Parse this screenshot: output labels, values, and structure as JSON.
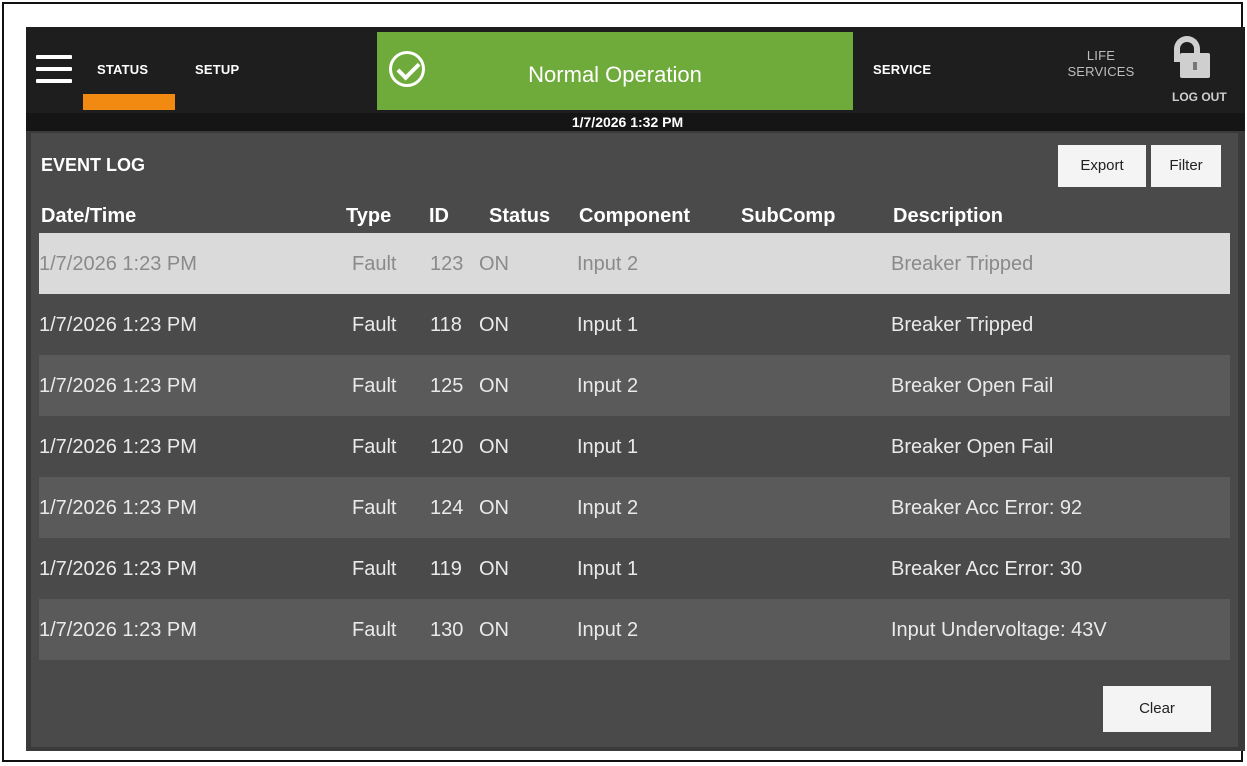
{
  "header": {
    "nav": {
      "status": "STATUS",
      "setup": "SETUP",
      "service": "SERVICE",
      "life_services_line1": "LIFE",
      "life_services_line2": "SERVICES",
      "logout": "LOG OUT"
    },
    "banner": {
      "text": "Normal Operation",
      "color": "#6fab3b"
    },
    "datetime": "1/7/2026 1:32 PM",
    "accent_color": "#f28a12",
    "icons": [
      "menu-icon",
      "check-circle-icon",
      "unlocked-padlock-icon"
    ]
  },
  "event_log": {
    "title": "EVENT LOG",
    "buttons": {
      "export": "Export",
      "filter": "Filter",
      "clear": "Clear"
    },
    "columns": {
      "datetime": "Date/Time",
      "type": "Type",
      "id": "ID",
      "status": "Status",
      "component": "Component",
      "subcomp": "SubComp",
      "description": "Description"
    },
    "rows": [
      {
        "datetime": "1/7/2026 1:23 PM",
        "type": "Fault",
        "id": "123",
        "status": "ON",
        "component": "Input 2",
        "subcomp": "",
        "description": "Breaker Tripped"
      },
      {
        "datetime": "1/7/2026 1:23 PM",
        "type": "Fault",
        "id": "118",
        "status": "ON",
        "component": "Input 1",
        "subcomp": "",
        "description": "Breaker Tripped"
      },
      {
        "datetime": "1/7/2026 1:23 PM",
        "type": "Fault",
        "id": "125",
        "status": "ON",
        "component": "Input 2",
        "subcomp": "",
        "description": "Breaker Open Fail"
      },
      {
        "datetime": "1/7/2026 1:23 PM",
        "type": "Fault",
        "id": "120",
        "status": "ON",
        "component": "Input 1",
        "subcomp": "",
        "description": "Breaker Open Fail"
      },
      {
        "datetime": "1/7/2026 1:23 PM",
        "type": "Fault",
        "id": "124",
        "status": "ON",
        "component": "Input 2",
        "subcomp": "",
        "description": "Breaker Acc Error: 92"
      },
      {
        "datetime": "1/7/2026 1:23 PM",
        "type": "Fault",
        "id": "119",
        "status": "ON",
        "component": "Input 1",
        "subcomp": "",
        "description": "Breaker Acc Error: 30"
      },
      {
        "datetime": "1/7/2026 1:23 PM",
        "type": "Fault",
        "id": "130",
        "status": "ON",
        "component": "Input 2",
        "subcomp": "",
        "description": "Input Undervoltage: 43V"
      }
    ],
    "selected_row": 0
  }
}
